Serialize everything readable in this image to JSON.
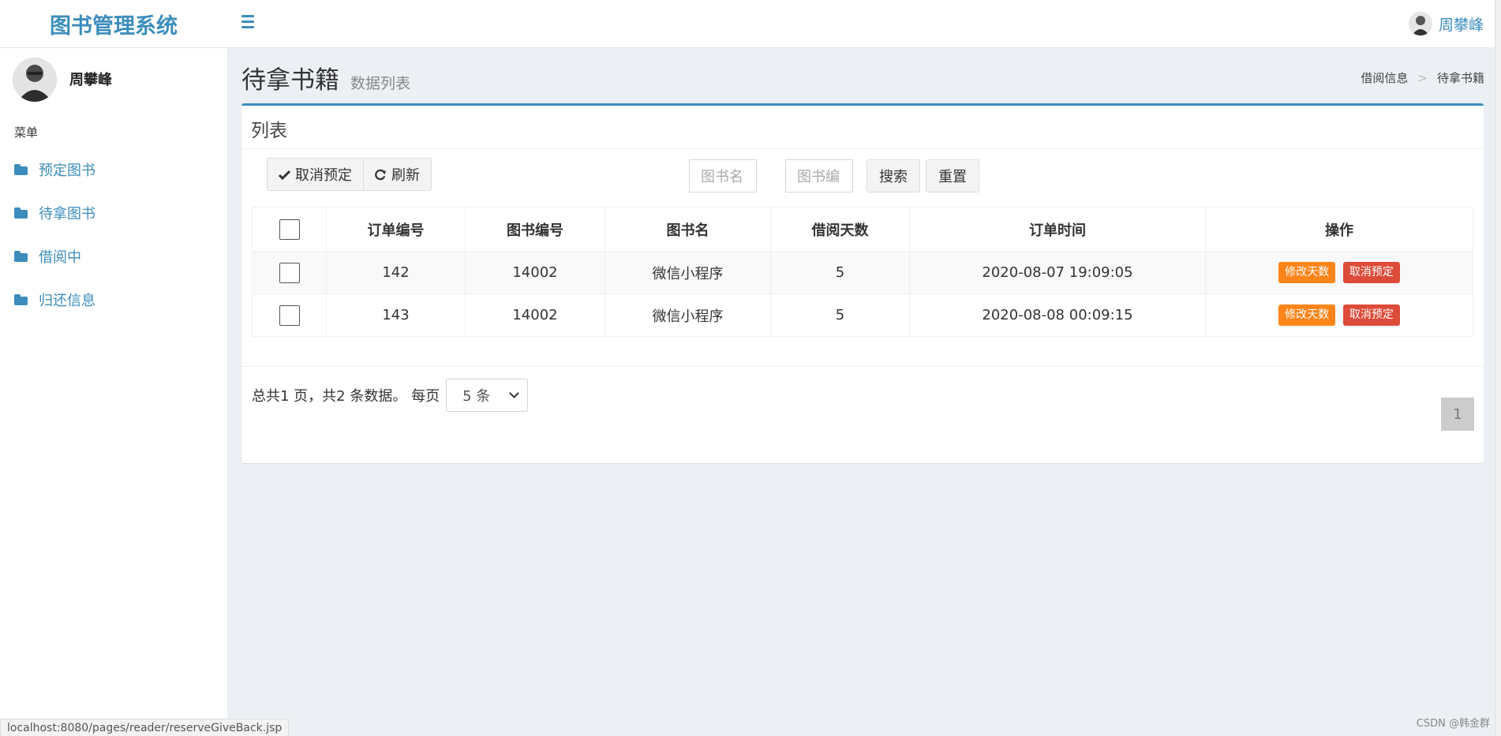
{
  "app": {
    "title": "图书管理系统"
  },
  "header": {
    "user_name": "周攀峰"
  },
  "sidebar": {
    "user_name": "周攀峰",
    "menu_header": "菜单",
    "items": [
      {
        "label": "预定图书",
        "icon": "folder-icon"
      },
      {
        "label": "待拿图书",
        "icon": "folder-icon"
      },
      {
        "label": "借阅中",
        "icon": "folder-icon"
      },
      {
        "label": "归还信息",
        "icon": "folder-icon"
      }
    ]
  },
  "page": {
    "title": "待拿书籍",
    "subtitle": "数据列表"
  },
  "breadcrumb": {
    "items": [
      "借阅信息",
      "待拿书籍"
    ],
    "separator": ">"
  },
  "box": {
    "title": "列表",
    "toolbar": {
      "cancel_label": "取消预定",
      "refresh_label": "刷新"
    },
    "search": {
      "book_name_placeholder": "图书名",
      "book_no_placeholder": "图书编",
      "search_label": "搜索",
      "reset_label": "重置"
    },
    "table": {
      "columns": [
        "订单编号",
        "图书编号",
        "图书名",
        "借阅天数",
        "订单时间",
        "操作"
      ],
      "rows": [
        {
          "order_no": "142",
          "book_no": "14002",
          "book_name": "微信小程序",
          "days": "5",
          "time": "2020-08-07 19:09:05"
        },
        {
          "order_no": "143",
          "book_no": "14002",
          "book_name": "微信小程序",
          "days": "5",
          "time": "2020-08-08 00:09:15"
        }
      ],
      "actions": {
        "edit_label": "修改天数",
        "cancel_label": "取消预定"
      }
    },
    "pagination": {
      "summary": "总共1 页，共2 条数据。 每页",
      "page_size": "5 条",
      "current_page": "1"
    }
  },
  "status_bar": {
    "url": "localhost:8080/pages/reader/reserveGiveBack.jsp"
  },
  "watermark": "CSDN @韩金群",
  "colors": {
    "accent": "#3c8dbc",
    "orange": "#ff851b",
    "red": "#dd4b39",
    "background": "#ecf0f5"
  }
}
